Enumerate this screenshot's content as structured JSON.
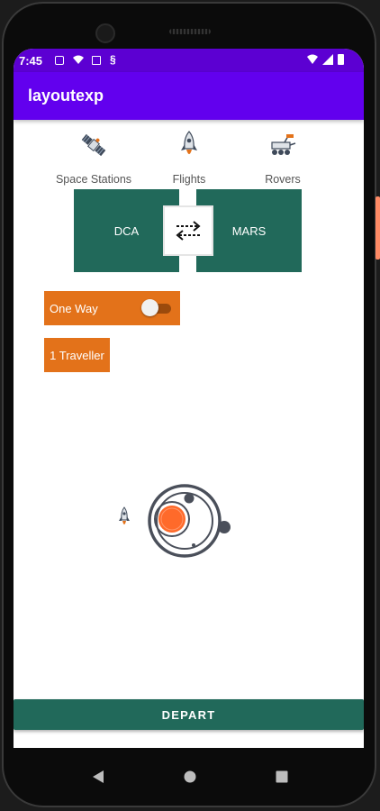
{
  "status_bar": {
    "time": "7:45"
  },
  "app_bar": {
    "title": "layoutexp"
  },
  "categories": [
    {
      "label": "Space Stations",
      "icon": "satellite-icon"
    },
    {
      "label": "Flights",
      "icon": "rocket-icon"
    },
    {
      "label": "Rovers",
      "icon": "rover-icon"
    }
  ],
  "route": {
    "from": "DCA",
    "to": "MARS",
    "swap_icon": "swap-arrows-icon"
  },
  "trip_type": {
    "label": "One Way",
    "toggle_on": false
  },
  "travellers": {
    "label": "1 Traveller"
  },
  "depart_button": {
    "label": "DEPART"
  },
  "colors": {
    "primary": "#6200ee",
    "status_bar": "#5c00d2",
    "teal": "#21695a",
    "orange": "#e3721a"
  }
}
